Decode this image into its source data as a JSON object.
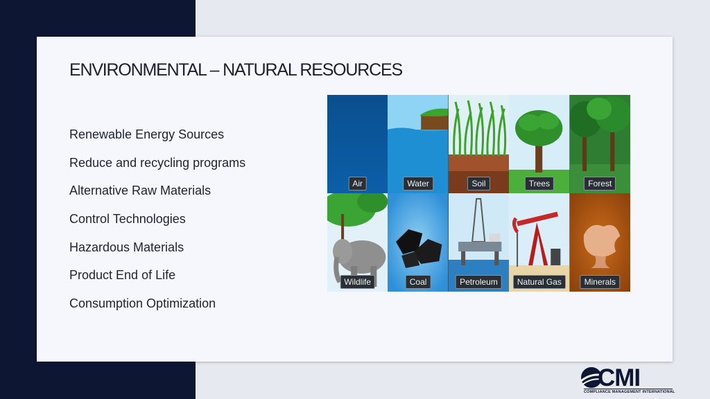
{
  "slide": {
    "title": "ENVIRONMENTAL – NATURAL RESOURCES",
    "bullets": [
      "Renewable Energy Sources",
      "Reduce and recycling programs",
      "Alternative Raw Materials",
      "Control Technologies",
      "Hazardous Materials",
      "Product End of Life",
      "Consumption Optimization"
    ]
  },
  "resources": {
    "tiles": [
      {
        "label": "Air",
        "icon": "air-icon"
      },
      {
        "label": "Water",
        "icon": "water-icon"
      },
      {
        "label": "Soil",
        "icon": "soil-icon"
      },
      {
        "label": "Trees",
        "icon": "tree-icon"
      },
      {
        "label": "Forest",
        "icon": "forest-icon"
      },
      {
        "label": "Wildlife",
        "icon": "elephant-icon"
      },
      {
        "label": "Coal",
        "icon": "coal-icon"
      },
      {
        "label": "Petroleum",
        "icon": "oil-rig-icon"
      },
      {
        "label": "Natural Gas",
        "icon": "gas-pump-jack-icon"
      },
      {
        "label": "Minerals",
        "icon": "minerals-icon"
      }
    ]
  },
  "logo": {
    "word": "CMI",
    "subtitle": "COMPLIANCE MANAGEMENT INTERNATIONAL"
  },
  "colors": {
    "dark_band": "#0d1633",
    "card": "#f5f7fc",
    "background": "#e6e9f0"
  }
}
